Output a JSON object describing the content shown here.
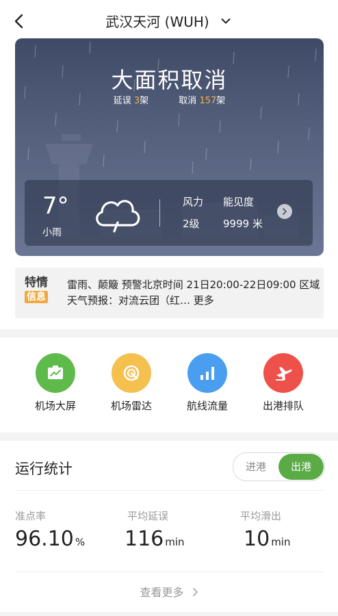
{
  "header": {
    "airport": "武汉天河 (WUH)"
  },
  "banner": {
    "status": "大面积取消",
    "delayed_label": "延误",
    "delayed_count": "3",
    "delayed_unit": "架",
    "cancelled_label": "取消",
    "cancelled_count": "157",
    "cancelled_unit": "架",
    "weather": {
      "temperature": "7°",
      "condition": "小雨",
      "wind_label": "风力",
      "wind_value": "2级",
      "visibility_label": "能见度",
      "visibility_value": "9999 米",
      "icon": "cloud-rain-icon"
    }
  },
  "notice": {
    "badge_top": "特情",
    "badge_bottom": "信息",
    "text": "雷雨、颠簸  预警北京时间 21日20:00-22日09:00 区域天气预报：对流云团（红…",
    "more": "更多"
  },
  "shortcuts": [
    {
      "label": "机场大屏",
      "icon": "screen-icon",
      "color": "#5fba4c"
    },
    {
      "label": "机场雷达",
      "icon": "radar-icon",
      "color": "#f4c04e"
    },
    {
      "label": "航线流量",
      "icon": "bar-chart-icon",
      "color": "#4a9ef0"
    },
    {
      "label": "出港排队",
      "icon": "plane-icon",
      "color": "#ee5149"
    }
  ],
  "stats": {
    "title": "运行统计",
    "toggle_in": "进港",
    "toggle_out": "出港",
    "ontime_label": "准点率",
    "ontime_value": "96.10",
    "ontime_unit": "%",
    "avg_delay_label": "平均延误",
    "avg_delay_value": "116",
    "avg_delay_unit": "min",
    "avg_taxi_label": "平均滑出",
    "avg_taxi_value": "10",
    "avg_taxi_unit": "min",
    "see_more": "查看更多"
  },
  "colors": {
    "accent_green": "#5aaa46",
    "highlight_orange": "#f2b34d"
  }
}
